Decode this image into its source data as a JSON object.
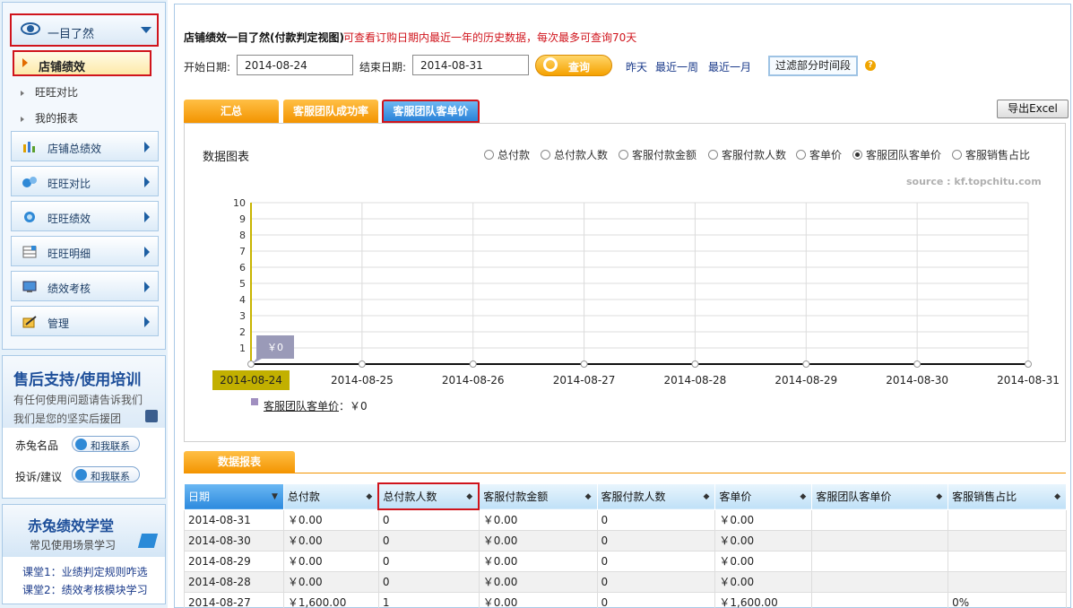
{
  "sidebar": {
    "header_label": "一目了然",
    "selected_label": "店铺绩效",
    "sub_items": [
      "旺旺对比",
      "我的报表"
    ],
    "nav_items": [
      {
        "label": "店铺总绩效",
        "icon": "bar-chart-icon"
      },
      {
        "label": "旺旺对比",
        "icon": "wangwang-compare-icon"
      },
      {
        "label": "旺旺绩效",
        "icon": "wangwang-icon"
      },
      {
        "label": "旺旺明细",
        "icon": "detail-grid-icon"
      },
      {
        "label": "绩效考核",
        "icon": "monitor-icon"
      },
      {
        "label": "管理",
        "icon": "manage-icon"
      }
    ],
    "support": {
      "title": "售后支持/使用培训",
      "line1": "有任何使用问题请告诉我们",
      "line2": "我们是您的坚实后援团",
      "rows": [
        {
          "label": "赤兔名品",
          "button": "和我联系"
        },
        {
          "label": "投诉/建议",
          "button": "和我联系"
        }
      ]
    },
    "school": {
      "title": "赤兔绩效学堂",
      "subtitle": "常见使用场景学习",
      "links": [
        "课堂1：业绩判定规则咋选",
        "课堂2：绩效考核模块学习"
      ]
    }
  },
  "main": {
    "title": "店铺绩效一目了然(付款判定视图)",
    "note": "可查看订购日期内最近一年的历史数据，每次最多可查询70天",
    "start_label": "开始日期:",
    "start_value": "2014-08-24",
    "end_label": "结束日期:",
    "end_value": "2014-08-31",
    "query_button": "查询",
    "quick_links": [
      "昨天",
      "最近一周",
      "最近一月"
    ],
    "filter_button": "过滤部分时间段",
    "help_glyph": "?",
    "tabs": [
      "汇总",
      "客服团队成功率",
      "客服团队客单价"
    ],
    "export_button": "导出Excel",
    "chart_heading": "数据图表",
    "radio_options": [
      "总付款",
      "总付款人数",
      "客服付款金额",
      "客服付款人数",
      "客单价",
      "客服团队客单价",
      "客服销售占比"
    ],
    "radio_selected_index": 5,
    "source": "source : kf.topchitu.com",
    "legend_label": "客服团队客单价",
    "legend_value": "：￥0",
    "report_tab": "数据报表"
  },
  "chart_data": {
    "type": "line",
    "x": [
      "2014-08-24",
      "2014-08-25",
      "2014-08-26",
      "2014-08-27",
      "2014-08-28",
      "2014-08-29",
      "2014-08-30",
      "2014-08-31"
    ],
    "series": [
      {
        "name": "客服团队客单价",
        "values": [
          0,
          0,
          0,
          0,
          0,
          0,
          0,
          0
        ]
      }
    ],
    "ylim": [
      0,
      10
    ],
    "yticks": [
      1,
      2,
      3,
      4,
      5,
      6,
      7,
      8,
      9,
      10
    ],
    "tooltip": "￥0",
    "highlighted_x": "2014-08-24",
    "grid": true,
    "colors": {
      "line": "#111111",
      "axis": "#c8b400",
      "tooltip": "#9a9ab8",
      "highlight": "#c2b000"
    }
  },
  "table": {
    "headers": [
      "日期",
      "总付款",
      "总付款人数",
      "客服付款金额",
      "客服付款人数",
      "客单价",
      "客服团队客单价",
      "客服销售占比"
    ],
    "rows": [
      [
        "2014-08-31",
        "￥0.00",
        "0",
        "￥0.00",
        "0",
        "￥0.00",
        "",
        ""
      ],
      [
        "2014-08-30",
        "￥0.00",
        "0",
        "￥0.00",
        "0",
        "￥0.00",
        "",
        ""
      ],
      [
        "2014-08-29",
        "￥0.00",
        "0",
        "￥0.00",
        "0",
        "￥0.00",
        "",
        ""
      ],
      [
        "2014-08-28",
        "￥0.00",
        "0",
        "￥0.00",
        "0",
        "￥0.00",
        "",
        ""
      ],
      [
        "2014-08-27",
        "￥1,600.00",
        "1",
        "￥0.00",
        "0",
        "￥1,600.00",
        "",
        "0%"
      ]
    ]
  }
}
